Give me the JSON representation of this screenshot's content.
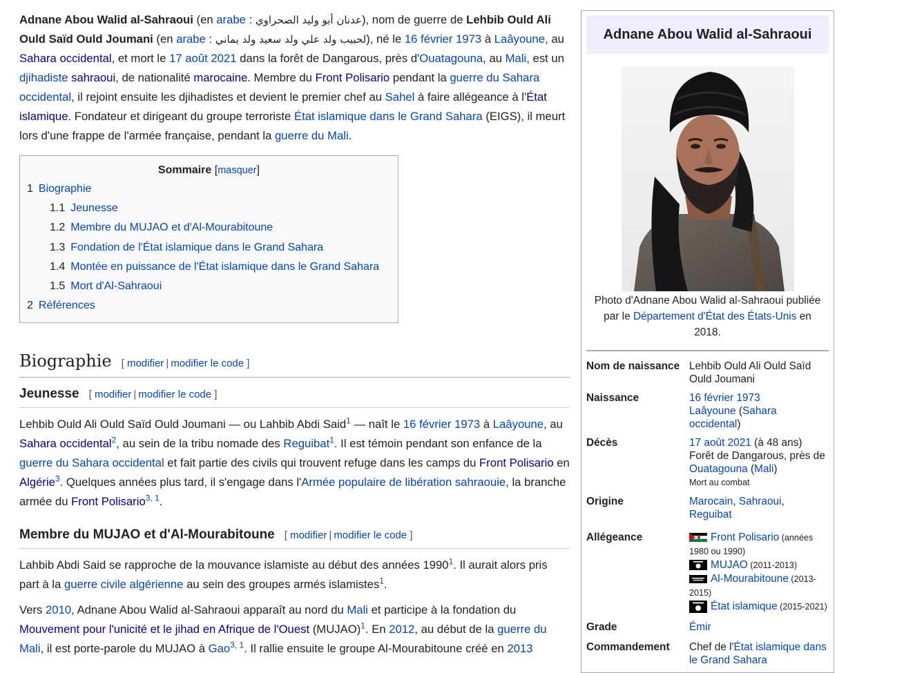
{
  "intro": {
    "name": "Adnane Abou Walid al-Sahraoui",
    "en1": " (en ",
    "arabe": "arabe",
    "colon": " : ",
    "ar_name": "عدنان أبو وليد الصحراوي",
    "nom_de_guerre": "), nom de guerre de ",
    "birth_name": "Lehbib Ould Ali Ould Saïd Ould Joumani",
    "ar_birth": "لحبيب ولد علي ولد سعيد ولد يماني",
    "ne_le": "), né le ",
    "date_birth": "16 février 1973",
    "a": " à ",
    "laayoune": "Laâyoune",
    "au": ", au ",
    "sahara_occ": "Sahara occidental",
    "mort": ", et mort le ",
    "date_death": "17 août 2021",
    "foret": " dans la forêt de Dangarous, près d'",
    "ouatagouna": "Ouatagouna",
    "au2": ", au ",
    "mali": "Mali",
    "est_un": ", est un ",
    "djihadiste": "djihadiste",
    "sp": " ",
    "sahraoui": "sahraoui",
    "nationalite": ", de nationalité ",
    "marocaine": "marocaine",
    "membre": ". Membre du ",
    "front": "Front Polisario",
    "pendant": " pendant la ",
    "guerre_sahara": "guerre du Sahara occidental",
    "rejoint": ", il rejoint ensuite les djihadistes et devient le premier chef au ",
    "sahel": "Sahel",
    "allegeance": " à faire allégeance à l'",
    "etat_islamique": "État islamique",
    "fondateur": ". Fondateur et dirigeant du groupe terroriste ",
    "eigs": "État islamique dans le Grand Sahara",
    "eigs_abbr": " (EIGS), il meurt lors d'une frappe de l'armée française, pendant la ",
    "guerre_mali": "guerre du Mali",
    "dot": "."
  },
  "toc": {
    "title": "Sommaire",
    "mask": "masquer",
    "items": [
      {
        "num": "1",
        "label": "Biographie"
      },
      {
        "num": "1.1",
        "label": "Jeunesse"
      },
      {
        "num": "1.2",
        "label": "Membre du MUJAO et d'Al-Mourabitoune"
      },
      {
        "num": "1.3",
        "label": "Fondation de l'État islamique dans le Grand Sahara"
      },
      {
        "num": "1.4",
        "label": "Montée en puissance de l'État islamique dans le Grand Sahara"
      },
      {
        "num": "1.5",
        "label": "Mort d'Al-Sahraoui"
      },
      {
        "num": "2",
        "label": "Références"
      }
    ]
  },
  "edit": {
    "modifier": "modifier",
    "modifier_code": "modifier le code"
  },
  "bio": {
    "heading": "Biographie"
  },
  "jeunesse": {
    "heading": "Jeunesse",
    "t1": "Lehbib Ould Ali Ould Saïd Ould Joumani — ou Lahbib Abdi Said",
    "r1": "1",
    "t2": " — naît le ",
    "date": "16 février 1973",
    "t3": " à ",
    "laayoune": "Laâyoune",
    "t4": ", au ",
    "sahara": "Sahara occidental",
    "r2": "2",
    "t5": ", au sein de la tribu nomade des ",
    "reguibat": "Reguibat",
    "r3": "1",
    "t6": ". Il est témoin pendant son enfance de la ",
    "guerre": "guerre du Sahara occidental",
    "t7": " et fait partie des civils qui trouvent refuge dans les camps du ",
    "front": "Front Polisario",
    "t8": " en ",
    "algerie": "Algérie",
    "r4": "3",
    "t9": ". Quelques années plus tard, il s'engage dans l'",
    "apls": "Armée populaire de libération sahraouie",
    "t10": ", la branche armée du ",
    "front2": "Front Polisario",
    "r5": "3, 1",
    "t11": "."
  },
  "mujao": {
    "heading": "Membre du MUJAO et d'Al-Mourabitoune",
    "p1a": "Lahbib Abdi Said se rapproche de la mouvance islamiste au début des années 1990",
    "r1": "1",
    "p1b": ". Il aurait alors pris part à la ",
    "guerre_civile": "guerre civile algérienne",
    "p1c": " au sein des groupes armés islamistes",
    "r2": "1",
    "p1d": ".",
    "p2a": "Vers ",
    "y2010": "2010",
    "p2b": ", Adnane Abou Walid al-Sahraoui apparaît au nord du ",
    "mali": "Mali",
    "p2c": " et participe à la fondation du ",
    "mujao_link": "Mouvement pour l'unicité et le jihad en Afrique de l'Ouest",
    "p2d": " (MUJAO)",
    "r3": "1",
    "p2e": ". En ",
    "y2012": "2012",
    "p2f": ", au début de la ",
    "guerre_mali": "guerre du Mali",
    "p2g": ", il est porte-parole du MUJAO à ",
    "gao": "Gao",
    "r4": "3, 1",
    "p2h": ". Il rallie ensuite le groupe Al-Mourabitoune créé en ",
    "y2013": "2013"
  },
  "infobox": {
    "title": "Adnane Abou Walid al-Sahraoui",
    "caption1": "Photo d'Adnane Abou Walid al-Sahraoui publiée par le ",
    "caption_link": "Département d'État des États-Unis",
    "caption2": " en 2018.",
    "rows": {
      "nom_k": "Nom de naissance",
      "nom_v": "Lehbib Ould Ali Ould Saïd Ould Joumani",
      "naiss_k": "Naissance",
      "naiss_date": "16 février 1973",
      "naiss_place": "Laâyoune",
      "naiss_region": "Sahara occidental",
      "deces_k": "Décès",
      "deces_date": "17 août 2021",
      "deces_age": " (à 48 ans)",
      "deces_place": "Forêt de Dangarous, près de ",
      "deces_town": "Ouatagouna",
      "deces_country": "Mali",
      "deces_cause": "Mort au combat",
      "origine_k": "Origine",
      "origine_1": "Marocain",
      "origine_2": "Sahraoui",
      "origine_3": "Reguibat",
      "alleg_k": "Allégeance",
      "alleg_1": "Front Polisario",
      "alleg_1d": " (années 1980 ou 1990)",
      "alleg_2": "MUJAO",
      "alleg_2d": " (2011-2013)",
      "alleg_3": "Al-Mourabitoune",
      "alleg_3d": " (2013-2015)",
      "alleg_4": "État islamique",
      "alleg_4d": " (2015-2021)",
      "grade_k": "Grade",
      "grade_v": "Émir",
      "cmd_k": "Commandement",
      "cmd_v1": "Chef de l'",
      "cmd_link": "État islamique dans le Grand Sahara"
    }
  },
  "colors": {
    "link": "#0645ad",
    "visited": "#0b0080",
    "text": "#202122",
    "infobox_title_bg": "#eeeeff",
    "border": "#a2a9b1"
  },
  "icons": [
    "sahrawi-flag-icon",
    "black-flag-icon"
  ]
}
